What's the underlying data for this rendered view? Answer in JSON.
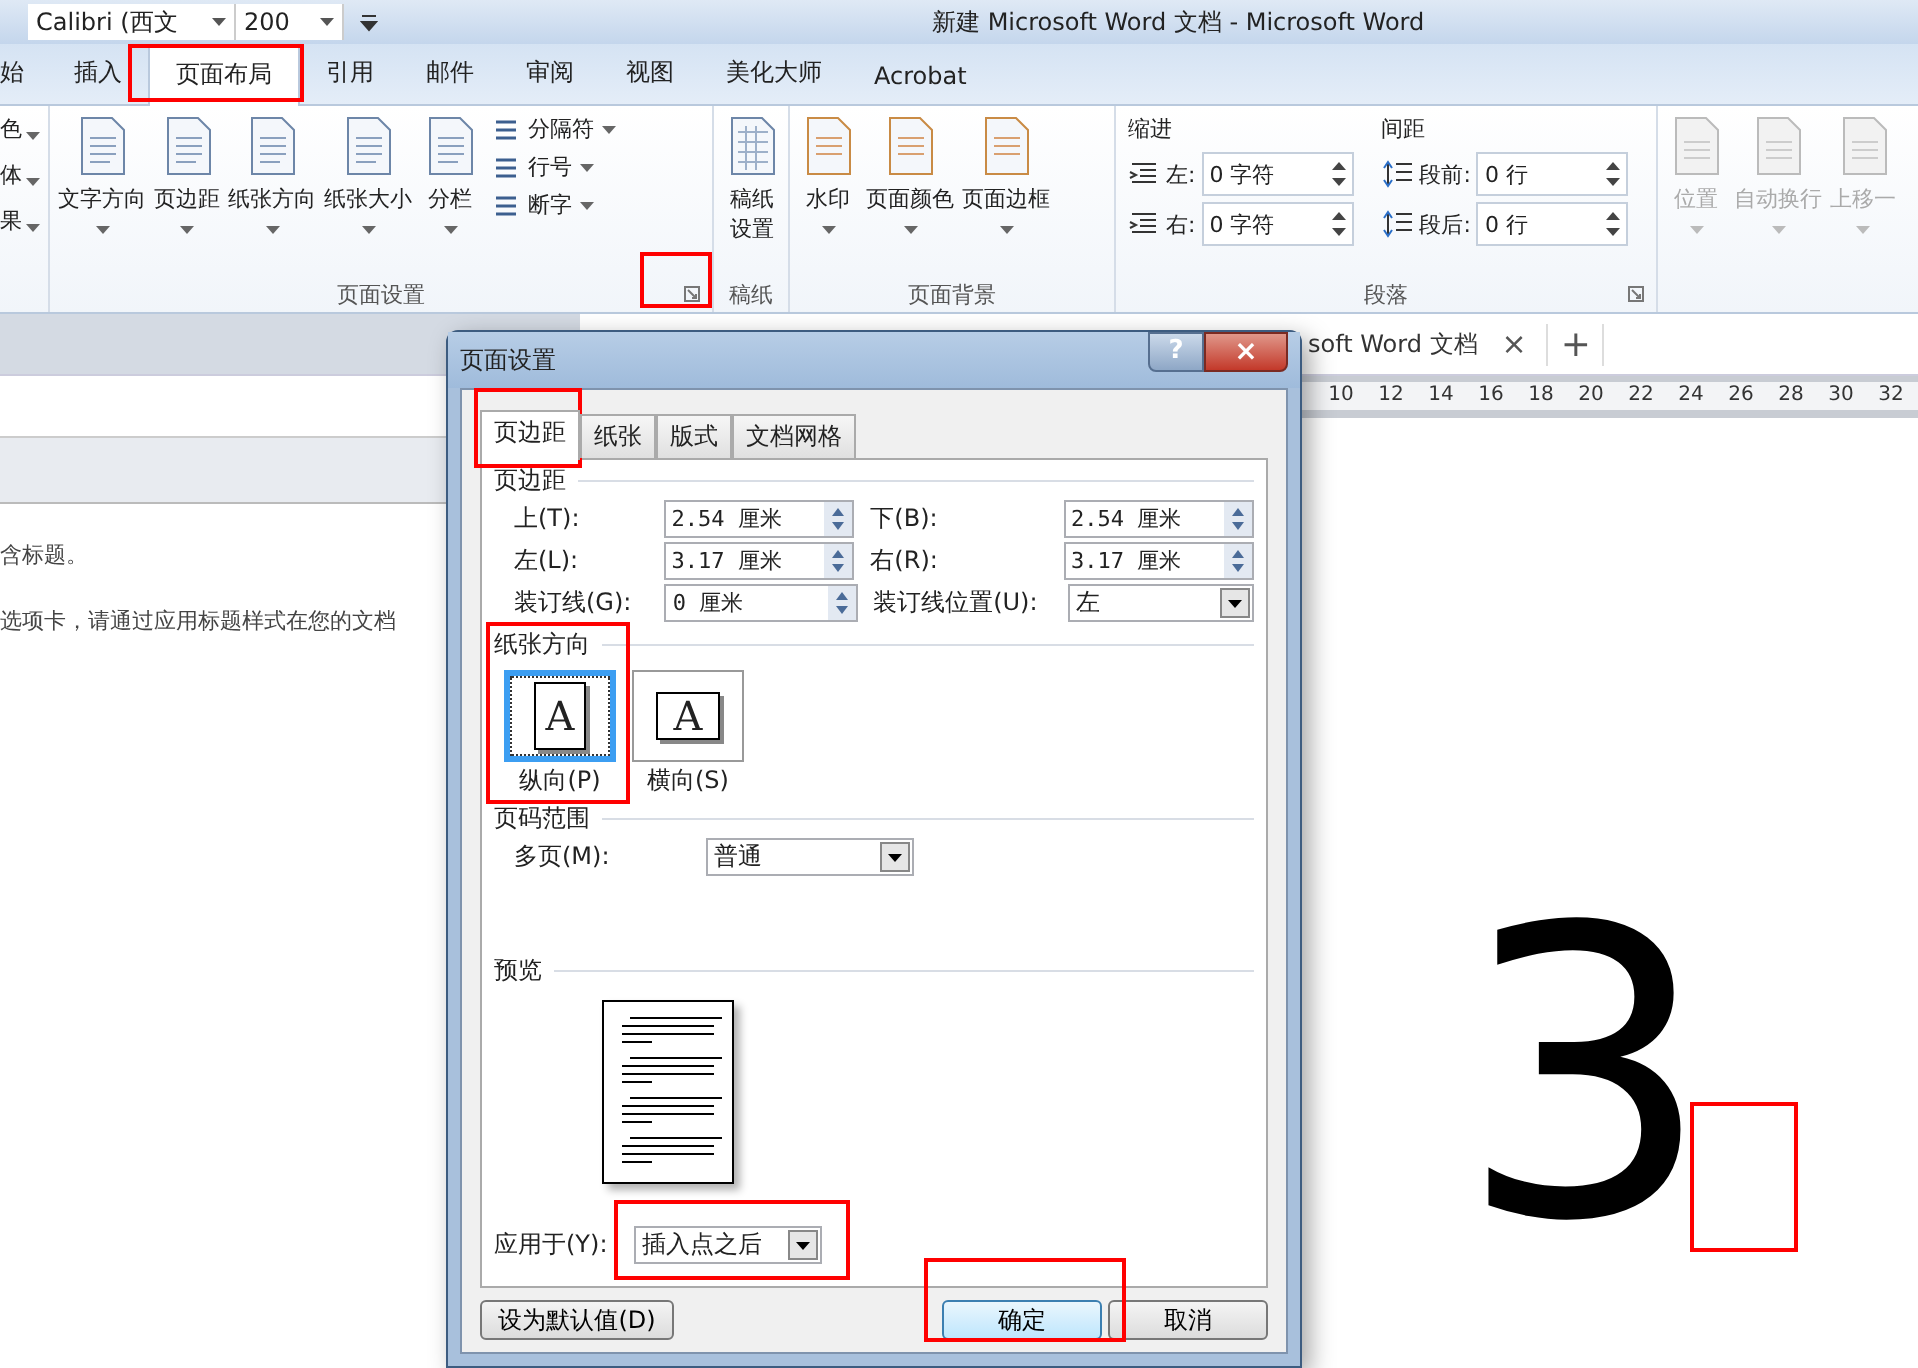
{
  "title_bar": {
    "font_name": "Calibri (西文",
    "font_size": "200",
    "title": "新建 Microsoft Word 文档  -  Microsoft Word"
  },
  "tabs": [
    {
      "label": "始",
      "selected": false
    },
    {
      "label": "插入",
      "selected": false
    },
    {
      "label": "页面布局",
      "selected": true
    },
    {
      "label": "引用",
      "selected": false
    },
    {
      "label": "邮件",
      "selected": false
    },
    {
      "label": "审阅",
      "selected": false
    },
    {
      "label": "视图",
      "selected": false
    },
    {
      "label": "美化大师",
      "selected": false
    },
    {
      "label": "Acrobat",
      "selected": false
    }
  ],
  "ribbon": {
    "theme_items": [
      "色",
      "体",
      "果"
    ],
    "page_setup": {
      "label": "页面设置",
      "buttons": [
        "文字方向",
        "页边距",
        "纸张方向",
        "纸张大小",
        "分栏"
      ],
      "small_buttons": [
        "分隔符",
        "行号",
        "断字"
      ]
    },
    "manuscript": {
      "label": "稿纸",
      "button": "稿纸设置"
    },
    "background": {
      "label": "页面背景",
      "buttons": [
        "水印",
        "页面颜色",
        "页面边框"
      ]
    },
    "paragraph": {
      "label": "段落",
      "indent_title": "缩进",
      "spacing_title": "间距",
      "indent": [
        {
          "label": "左:",
          "value": "0 字符"
        },
        {
          "label": "右:",
          "value": "0 字符"
        }
      ],
      "spacing": [
        {
          "label": "段前:",
          "value": "0 行"
        },
        {
          "label": "段后:",
          "value": "0 行"
        }
      ]
    },
    "arrange": [
      {
        "label": "位置",
        "disabled": true
      },
      {
        "label": "自动换行",
        "disabled": true
      },
      {
        "label": "上移一",
        "disabled": true
      }
    ]
  },
  "doc_tab": {
    "title": "soft Word 文档",
    "close": "×",
    "new": "+"
  },
  "ruler_marks": [
    "10",
    "12",
    "14",
    "16",
    "18",
    "20",
    "22",
    "24",
    "26",
    "28",
    "30",
    "32"
  ],
  "nav_pane": {
    "lines": [
      "含标题。",
      "选项卡，请通过应用标题样式在您的文档"
    ]
  },
  "step_number": "3",
  "dialog": {
    "title": "页面设置",
    "help": "?",
    "close": "×",
    "tabs": [
      {
        "label": "页边距",
        "selected": true
      },
      {
        "label": "纸张",
        "selected": false
      },
      {
        "label": "版式",
        "selected": false
      },
      {
        "label": "文档网格",
        "selected": false
      }
    ],
    "margins_title": "页边距",
    "margins": [
      {
        "label": "上(T):",
        "value": "2.54 厘米",
        "label2": "下(B):",
        "value2": "2.54 厘米"
      },
      {
        "label": "左(L):",
        "value": "3.17 厘米",
        "label2": "右(R):",
        "value2": "3.17 厘米"
      }
    ],
    "gutter": {
      "label": "装订线(G):",
      "value": "0 厘米",
      "pos_label": "装订线位置(U):",
      "pos_value": "左"
    },
    "orientation_title": "纸张方向",
    "orientations": [
      {
        "label": "纵向(P)",
        "glyph": "A",
        "kind": "portrait",
        "selected": true
      },
      {
        "label": "横向(S)",
        "glyph": "A",
        "kind": "landscape",
        "selected": false
      }
    ],
    "pages_title": "页码范围",
    "pages_label": "多页(M):",
    "pages_value": "普通",
    "preview_title": "预览",
    "apply_label": "应用于(Y):",
    "apply_value": "插入点之后",
    "buttons": [
      {
        "label": "设为默认值(D)",
        "kind": "default"
      },
      {
        "label": "确定",
        "kind": "primary"
      },
      {
        "label": "取消",
        "kind": "normal"
      }
    ]
  }
}
